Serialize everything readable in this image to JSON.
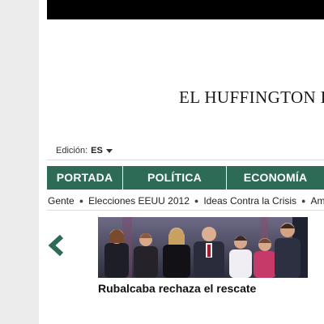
{
  "site": {
    "logo_text": "EL HUFFINGTON POST"
  },
  "edition": {
    "label": "Edición:",
    "value": "ES",
    "caret_icon": "caret-down-icon"
  },
  "main_nav": {
    "background": "#2e6b56",
    "items": [
      {
        "label": "PORTADA"
      },
      {
        "label": "POLÍTICA"
      },
      {
        "label": "ECONOMÍA"
      }
    ]
  },
  "sub_nav": {
    "items": [
      {
        "label": "Gente"
      },
      {
        "label": "Elecciones EEUU 2012"
      },
      {
        "label": "Ideas Contra la Crisis"
      },
      {
        "label": "Am"
      }
    ]
  },
  "carousel": {
    "prev_icon": "chevron-left-icon",
    "arrow_color": "#2e6b56",
    "photo_icon": "news-photo",
    "headline": "Rubalcaba rechaza el rescate"
  }
}
